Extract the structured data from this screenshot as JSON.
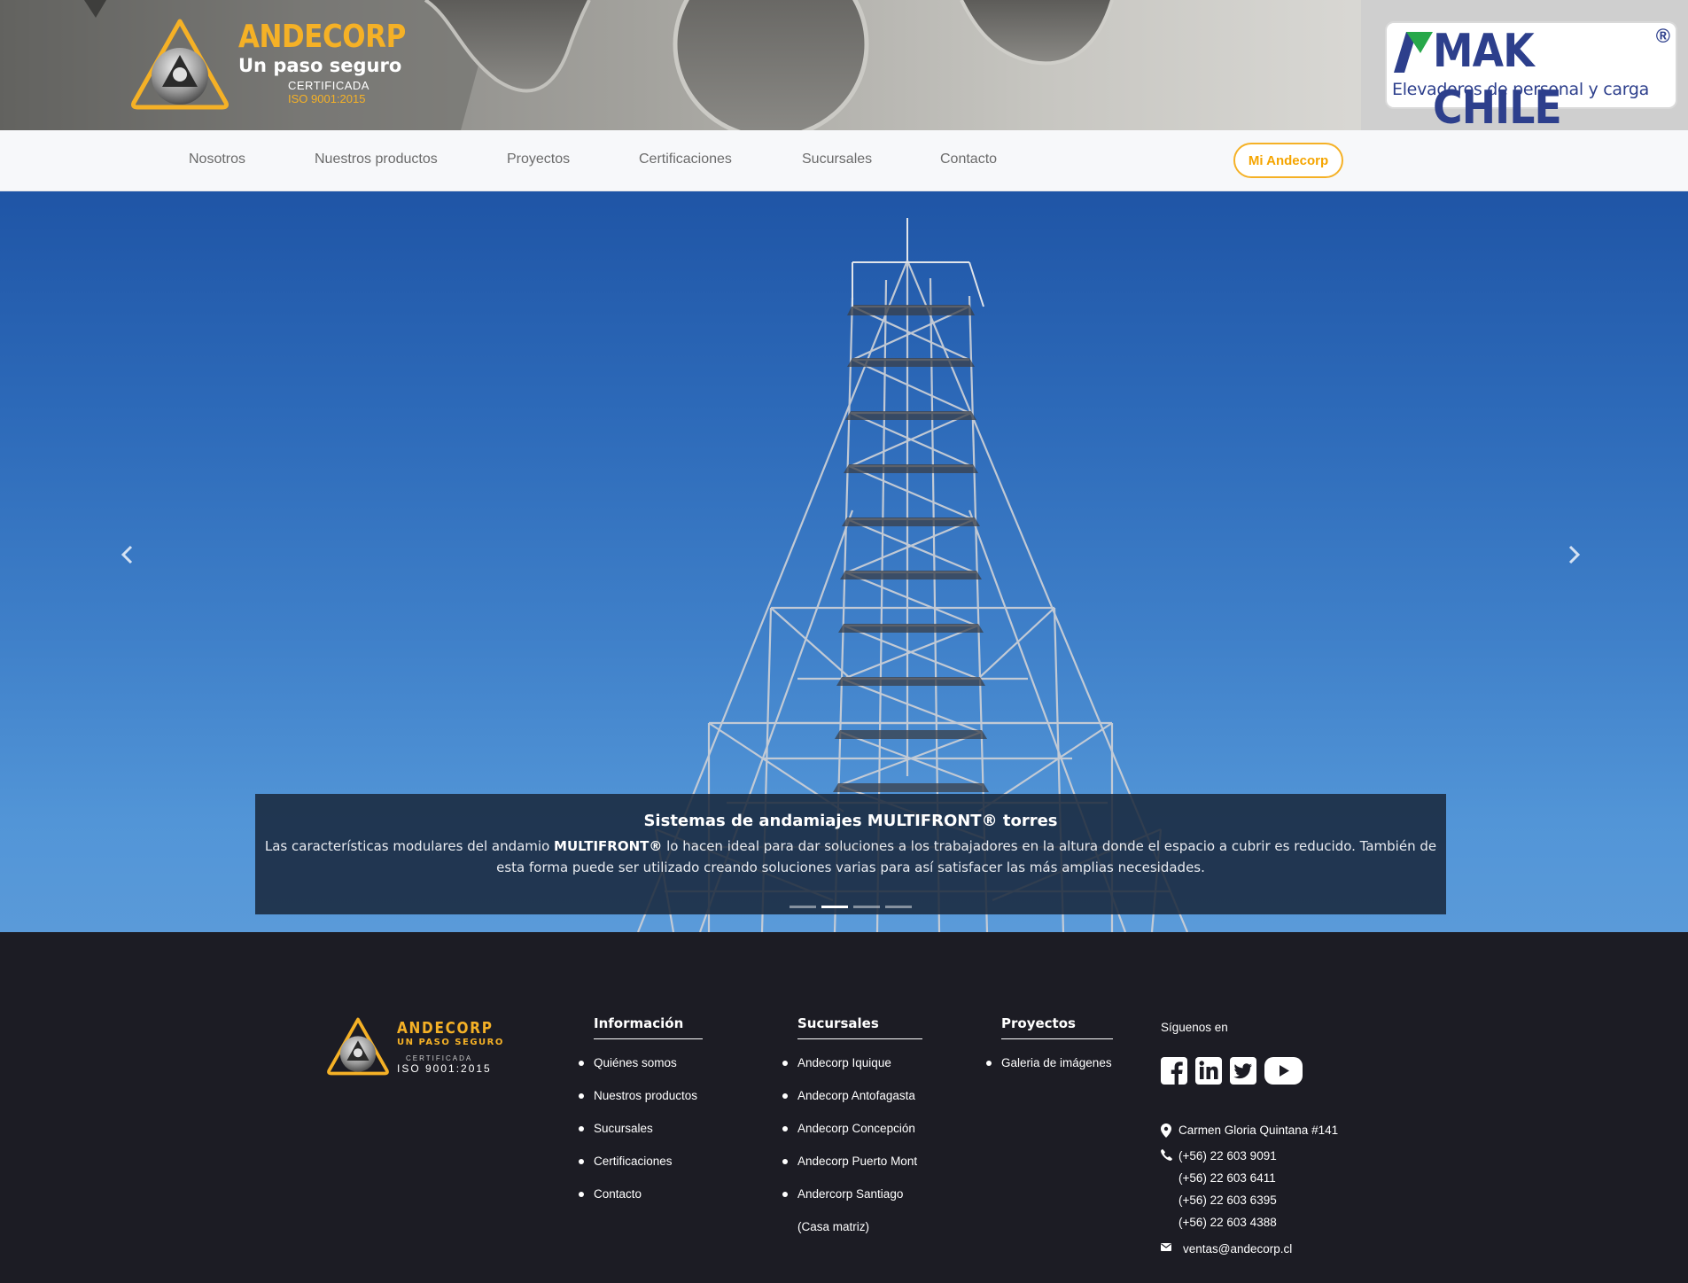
{
  "header": {
    "brand_name": "ANDECORP",
    "brand_tagline": "Un paso seguro",
    "brand_cert": "CERTIFICADA",
    "brand_iso": "ISO 9001:2015",
    "partner_name": "MAK CHILE",
    "partner_reg": "®",
    "partner_subtitle": "Elevadores de personal y carga"
  },
  "nav": {
    "items": [
      {
        "label": "Nosotros"
      },
      {
        "label": "Nuestros productos"
      },
      {
        "label": "Proyectos"
      },
      {
        "label": "Certificaciones"
      },
      {
        "label": "Sucursales"
      },
      {
        "label": "Contacto"
      }
    ],
    "cta": "Mi Andecorp"
  },
  "hero": {
    "caption_title": "Sistemas de andamiajes MULTIFRONT® torres",
    "caption_body_pre": "Las características modulares del andamio ",
    "caption_body_bold": "MULTIFRONT®",
    "caption_body_post": " lo hacen ideal para dar soluciones a los trabajadores en la altura donde el espacio a cubrir es reducido. También de esta forma puede ser utilizado creando soluciones varias para así satisfacer las más amplias necesidades.",
    "prev_icon": "chevron-left-icon",
    "next_icon": "chevron-right-icon",
    "slide_count": 4,
    "active_slide": 2
  },
  "footer": {
    "brand_name": "ANDECORP",
    "brand_tagline": "UN PASO SEGURO",
    "brand_cert": "CERTIFICADA",
    "brand_iso": "ISO 9001:2015",
    "info": {
      "heading": "Información",
      "items": [
        "Quiénes somos",
        "Nuestros productos",
        "Sucursales",
        "Certificaciones",
        "Contacto"
      ]
    },
    "branches": {
      "heading": "Sucursales",
      "items": [
        "Andecorp Iquique",
        "Andecorp Antofagasta",
        "Andecorp Concepción",
        "Andecorp Puerto Mont",
        "Andercorp Santiago",
        "(Casa matriz)"
      ]
    },
    "projects": {
      "heading": "Proyectos",
      "items": [
        "Galeria de imágenes"
      ]
    },
    "social": {
      "title": "Síguenos en",
      "icons": [
        "facebook-icon",
        "linkedin-icon",
        "twitter-icon",
        "youtube-icon"
      ]
    },
    "contact": {
      "address": "Carmen Gloria Quintana #141",
      "phones": [
        "(+56) 22 603 9091",
        "(+56) 22 603 6411",
        "(+56) 22 603 6395",
        "(+56) 22 603 4388"
      ],
      "email": "ventas@andecorp.cl"
    }
  },
  "colors": {
    "accent": "#f5b126",
    "partner_blue": "#2d3f8c",
    "footer_bg": "#1c1c24",
    "nav_bg": "#f7f8fa"
  }
}
